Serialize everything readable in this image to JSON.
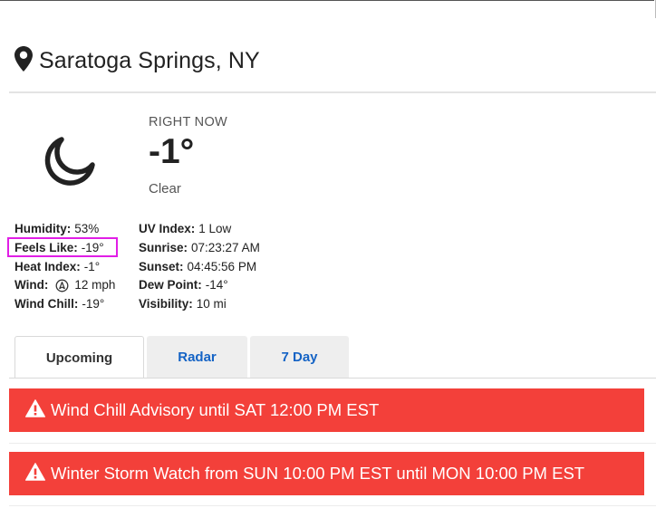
{
  "location": {
    "name": "Saratoga Springs, NY",
    "icon": "map-pin-icon"
  },
  "current": {
    "label": "RIGHT NOW",
    "temperature": "-1°",
    "condition": "Clear",
    "icon": "moon-icon"
  },
  "details_left": [
    {
      "label": "Humidity:",
      "value": "53%"
    },
    {
      "label": "Feels Like:",
      "value": "-19°"
    },
    {
      "label": "Heat Index:",
      "value": "-1°"
    },
    {
      "label": "Wind:",
      "value": "12 mph",
      "icon": "wind-direction-icon"
    },
    {
      "label": "Wind Chill:",
      "value": "-19°"
    }
  ],
  "details_right": [
    {
      "label": "UV Index:",
      "value": "1 Low"
    },
    {
      "label": "Sunrise:",
      "value": "07:23:27 AM"
    },
    {
      "label": "Sunset:",
      "value": "04:45:56 PM"
    },
    {
      "label": "Dew Point:",
      "value": "-14°"
    },
    {
      "label": "Visibility:",
      "value": "10 mi"
    }
  ],
  "tabs": [
    {
      "label": "Upcoming",
      "active": true
    },
    {
      "label": "Radar",
      "active": false
    },
    {
      "label": "7 Day",
      "active": false
    }
  ],
  "alerts": [
    {
      "text": "Wind Chill Advisory until SAT 12:00 PM EST",
      "icon": "warning-icon"
    },
    {
      "text": "Winter Storm Watch from SUN 10:00 PM EST until MON 10:00 PM EST",
      "icon": "warning-icon"
    }
  ],
  "colors": {
    "alert_bg": "#f3403a",
    "tab_link": "#1463c5",
    "highlight": "#e11ee6"
  }
}
